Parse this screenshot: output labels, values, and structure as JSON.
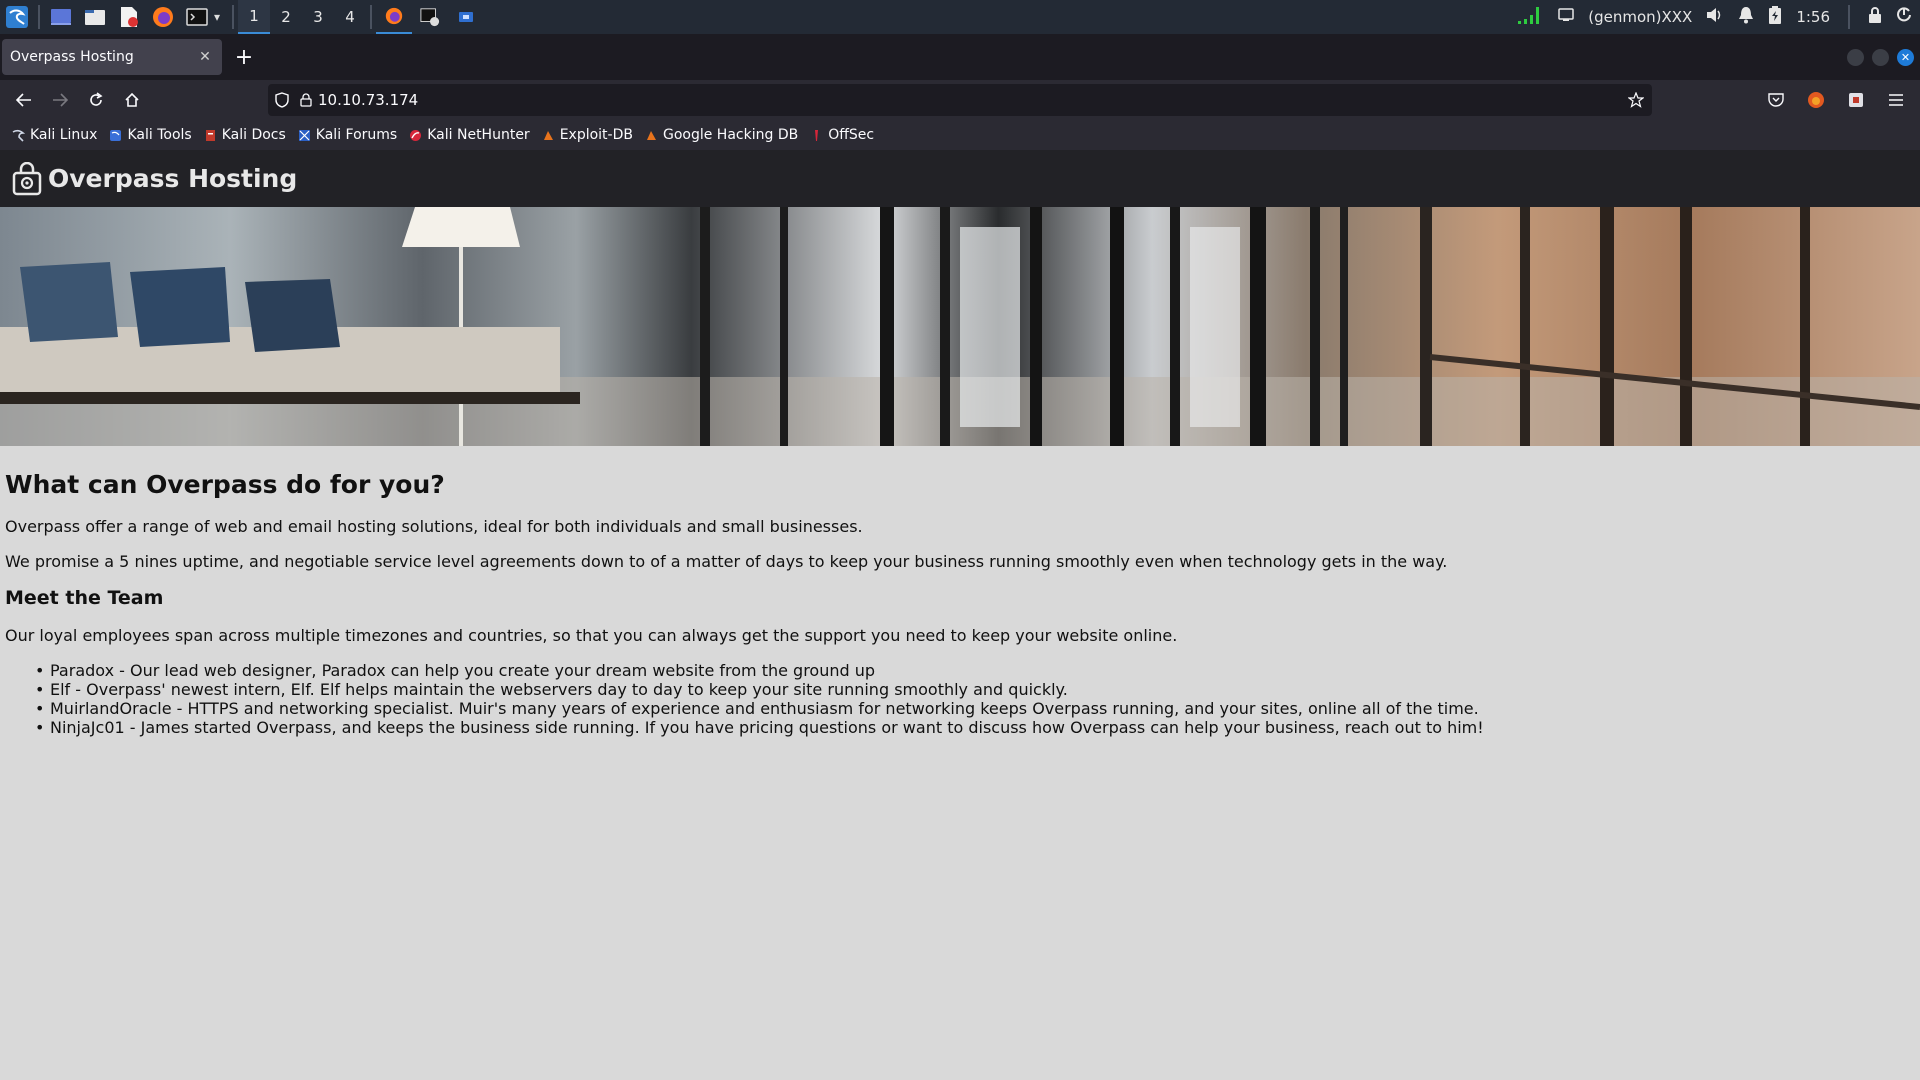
{
  "panel": {
    "workspaces": [
      "1",
      "2",
      "3",
      "4"
    ],
    "active_workspace": "1",
    "genmon": "(genmon)XXX",
    "clock": "1:56"
  },
  "browser": {
    "tab_title": "Overpass Hosting",
    "url": "10.10.73.174",
    "bookmarks": [
      "Kali Linux",
      "Kali Tools",
      "Kali Docs",
      "Kali Forums",
      "Kali NetHunter",
      "Exploit-DB",
      "Google Hacking DB",
      "OffSec"
    ]
  },
  "site": {
    "title": "Overpass Hosting",
    "heading": "What can Overpass do for you?",
    "intro1": "Overpass offer a range of web and email hosting solutions, ideal for both individuals and small businesses.",
    "intro2": "We promise a 5 nines uptime, and negotiable service level agreements down to of a matter of days to keep your business running smoothly even when technology gets in the way.",
    "team_heading": "Meet the Team",
    "team_intro": "Our loyal employees span across multiple timezones and countries, so that you can always get the support you need to keep your website online.",
    "team": [
      "Paradox - Our lead web designer, Paradox can help you create your dream website from the ground up",
      "Elf - Overpass' newest intern, Elf. Elf helps maintain the webservers day to day to keep your site running smoothly and quickly.",
      "MuirlandOracle - HTTPS and networking specialist. Muir's many years of experience and enthusiasm for networking keeps Overpass running, and your sites, online all of the time.",
      "NinjaJc01 - James started Overpass, and keeps the business side running. If you have pricing questions or want to discuss how Overpass can help your business, reach out to him!"
    ]
  },
  "colors": {
    "panel_bg": "#232a35",
    "browser_bg": "#2b2a33",
    "accent": "#3a8bd6",
    "page_bg": "#d9d9d9",
    "site_header_bg": "#222226"
  },
  "icons": {
    "panel": [
      "kali-menu-icon",
      "desktop-icon",
      "file-manager-icon",
      "text-editor-icon",
      "firefox-icon",
      "terminal-icon",
      "network-icon",
      "display-icon",
      "volume-icon",
      "bell-icon",
      "battery-icon",
      "lock-icon",
      "power-icon"
    ],
    "browser": [
      "back-icon",
      "forward-icon",
      "reload-icon",
      "home-icon",
      "shield-icon",
      "lock-icon",
      "star-icon",
      "pocket-icon",
      "firefox-account-icon",
      "extensions-icon",
      "menu-icon"
    ]
  }
}
